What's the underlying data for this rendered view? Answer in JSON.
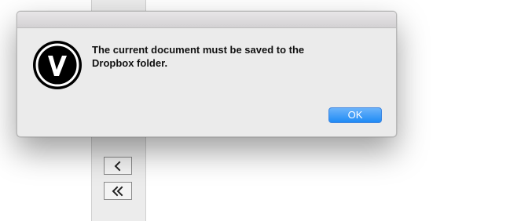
{
  "dialog": {
    "message": "The current document must be saved to the Dropbox folder.",
    "ok_label": "OK",
    "icon": "vectorworks-logo-icon"
  },
  "background": {
    "nav_buttons": [
      {
        "icon": "chevron-left-icon"
      },
      {
        "icon": "double-chevron-left-icon"
      }
    ]
  },
  "colors": {
    "accent": "#2a8cf6",
    "dialog_bg": "#ebebeb"
  }
}
